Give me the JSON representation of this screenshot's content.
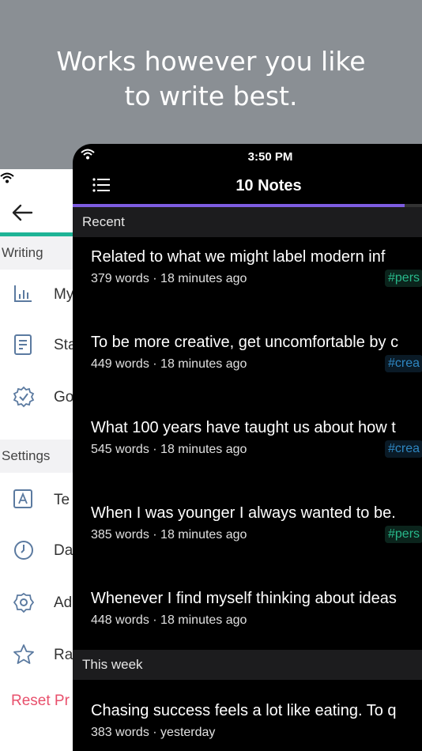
{
  "headline": {
    "line1": "Works however you like",
    "line2": "to write best."
  },
  "back_screen": {
    "section_writing": "Writing",
    "items_writing": [
      {
        "label": "My",
        "icon": "bar-chart-icon"
      },
      {
        "label": "Sta",
        "icon": "document-icon"
      },
      {
        "label": "Go",
        "icon": "badge-check-icon"
      }
    ],
    "section_settings": "Settings",
    "items_settings": [
      {
        "label": "Te",
        "icon": "text-a-icon"
      },
      {
        "label": "Da",
        "icon": "clock-icon"
      },
      {
        "label": "Ad",
        "icon": "gear-icon"
      },
      {
        "label": "Ra",
        "icon": "star-icon"
      }
    ],
    "reset_label": "Reset Pr",
    "accent_color": "#1fb496"
  },
  "front_screen": {
    "status_time": "3:50 PM",
    "nav_title": "10 Notes",
    "progress_percent": 95,
    "progress_color": "#7d5ce0",
    "sections": [
      {
        "label": "Recent",
        "notes": [
          {
            "title": "Related to what we might label  modern  inf",
            "meta": "379 words · 18 minutes ago",
            "tag": "#pers",
            "tag_kind": "personal"
          },
          {
            "title": "To be more creative, get uncomfortable by c",
            "meta": "449 words · 18 minutes ago",
            "tag": "#crea",
            "tag_kind": "creativity"
          },
          {
            "title": "What 100 years have taught us about how t",
            "meta": "545 words · 18 minutes ago",
            "tag": "#crea",
            "tag_kind": "creativity"
          },
          {
            "title": "When I was younger I always wanted to be.",
            "meta": "385 words · 18 minutes ago",
            "tag": "#pers",
            "tag_kind": "personal"
          },
          {
            "title": "Whenever I find myself thinking about ideas",
            "meta": "448 words · 18 minutes ago",
            "tag": "",
            "tag_kind": ""
          }
        ]
      },
      {
        "label": "This week",
        "notes": [
          {
            "title": "Chasing success feels a lot like eating. To q",
            "meta": "383 words · yesterday",
            "tag": "",
            "tag_kind": ""
          }
        ]
      }
    ]
  }
}
